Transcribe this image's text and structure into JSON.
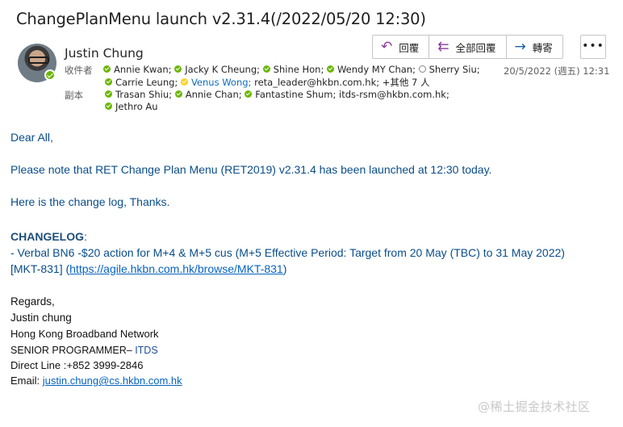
{
  "subject": "ChangePlanMenu launch v2.31.4(/2022/05/20 12:30)",
  "sender": {
    "name": "Justin Chung",
    "status": "available"
  },
  "toolbar": {
    "reply": "回覆",
    "reply_all": "全部回覆",
    "forward": "轉寄",
    "more": "•••"
  },
  "date": "20/5/2022 (週五) 12:31",
  "to_label": "收件者",
  "cc_label": "副本",
  "to_line1": [
    {
      "name": "Annie Kwan;",
      "status": "available"
    },
    {
      "name": "Jacky K Cheung;",
      "status": "available"
    },
    {
      "name": "Shine Hon;",
      "status": "available"
    },
    {
      "name": "Wendy MY Chan;",
      "status": "available"
    },
    {
      "name": "Sherry Siu;",
      "status": "offline"
    }
  ],
  "to_line2": [
    {
      "name": "Carrie Leung;",
      "status": "available"
    },
    {
      "name": "Venus Wong;",
      "status": "away"
    }
  ],
  "to_addr1": "reta_leader@hkbn.com.hk;",
  "to_more": "+其他 7 人",
  "cc_line1": [
    {
      "name": "Trasan Shiu;",
      "status": "available"
    },
    {
      "name": "Annie Chan;",
      "status": "available"
    },
    {
      "name": "Fantastine Shum;",
      "status": "available"
    }
  ],
  "cc_addr1": "itds-rsm@hkbn.com.hk;",
  "cc_line2": [
    {
      "name": "Jethro Au",
      "status": "available"
    }
  ],
  "body": {
    "greeting": "Dear All,",
    "line1": "Please note that RET Change Plan Menu (RET2019) v2.31.4 has been launched at 12:30 today.",
    "line2": "Here is the change log, Thanks.",
    "changelog_heading": "CHANGELOG",
    "changelog_colon": ":",
    "changelog_item": "- Verbal BN6 -$20 action for M+4 & M+5 cus (M+5 Effective Period: Target from 20 May (TBC) to 31 May 2022)",
    "ticket_prefix": "[MKT-831] (",
    "ticket_link": "https://agile.hkbn.com.hk/browse/MKT-831",
    "ticket_suffix": ")"
  },
  "signature": {
    "regards": "Regards,",
    "name": "Justin chung",
    "company": "Hong Kong Broadband Network",
    "title_prefix": "SENIOR PROGRAMMER– ",
    "title_dept": "ITDS",
    "direct_line": "Direct Line :+852 3999-2846",
    "email_label": "Email: ",
    "email": "justin.chung@cs.hkbn.com.hk"
  },
  "watermark": "@稀土掘金技术社区"
}
